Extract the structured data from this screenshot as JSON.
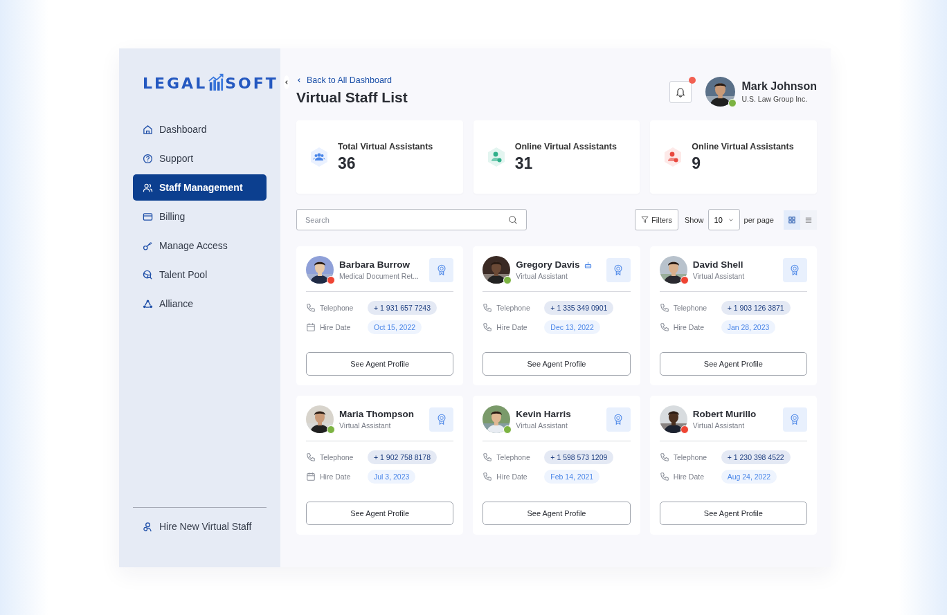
{
  "sidebar": {
    "logo": {
      "left": "LEGAL",
      "right": "SOFT"
    },
    "items": [
      {
        "label": "Dashboard",
        "selected": false
      },
      {
        "label": "Support",
        "selected": false
      },
      {
        "label": "Staff Management",
        "selected": true
      },
      {
        "label": "Billing",
        "selected": false
      },
      {
        "label": "Manage Access",
        "selected": false
      },
      {
        "label": "Talent Pool",
        "selected": false
      },
      {
        "label": "Alliance",
        "selected": false
      }
    ],
    "footer_item": {
      "label": "Hire New Virtual Staff"
    }
  },
  "header": {
    "back_link": "Back to All Dashboard",
    "title": "Virtual Staff List",
    "notification": true,
    "user": {
      "name": "Mark Johnson",
      "company": "U.S. Law Group Inc.",
      "online": true
    }
  },
  "stats": [
    {
      "kind": "group",
      "label": "Total Virtual Assistants",
      "value": "36"
    },
    {
      "kind": "online",
      "label": "Online Virtual Assistants",
      "value": "31"
    },
    {
      "kind": "offline",
      "label": "Online Virtual Assistants",
      "value": "9"
    }
  ],
  "toolbar": {
    "search_placeholder": "Search",
    "filters": "Filters",
    "show": "Show",
    "per_page_value": "10",
    "per_page": "per page",
    "views": [
      {
        "kind": "grid",
        "selected": true
      },
      {
        "kind": "list",
        "selected": false
      }
    ]
  },
  "staff": [
    {
      "name": "Barbara Burrow",
      "role": "Medical Document Ret...",
      "online": false,
      "badge": false,
      "telephone_label": "Telephone",
      "telephone": "+ 1 931 657 7243",
      "hire": {
        "kind": "calendar",
        "label": "Hire Date",
        "value": "Oct 15, 2022"
      },
      "button": "See Agent Profile"
    },
    {
      "name": "Gregory Davis",
      "role": "Virtual Assistant",
      "online": true,
      "badge": true,
      "telephone_label": "Telephone",
      "telephone": "+ 1 335 349 0901",
      "hire": {
        "kind": "phone",
        "label": "Hire Date",
        "value": "Dec 13, 2022"
      },
      "button": "See Agent Profile"
    },
    {
      "name": "David Shell",
      "role": "Virtual Assistant",
      "online": false,
      "badge": false,
      "telephone_label": "Telephone",
      "telephone": "+ 1 903 126 3871",
      "hire": {
        "kind": "phone",
        "label": "Hire Date",
        "value": "Jan 28, 2023"
      },
      "button": "See Agent Profile"
    },
    {
      "name": "Maria Thompson",
      "role": "Virtual Assistant",
      "online": true,
      "badge": false,
      "telephone_label": "Telephone",
      "telephone": "+ 1 902 758 8178",
      "hire": {
        "kind": "calendar",
        "label": "Hire Date",
        "value": "Jul 3, 2023"
      },
      "button": "See Agent Profile"
    },
    {
      "name": "Kevin Harris",
      "role": "Virtual Assistant",
      "online": true,
      "badge": false,
      "telephone_label": "Telephone",
      "telephone": "+ 1 598 573 1209",
      "hire": {
        "kind": "phone",
        "label": "Hire Date",
        "value": "Feb 14, 2021"
      },
      "button": "See Agent Profile"
    },
    {
      "name": "Robert Murillo",
      "role": "Virtual Assistant",
      "online": false,
      "badge": false,
      "telephone_label": "Telephone",
      "telephone": "+ 1 230 398 4522",
      "hire": {
        "kind": "phone",
        "label": "Hire Date",
        "value": "Aug 24, 2022"
      },
      "button": "See Agent Profile"
    }
  ]
}
